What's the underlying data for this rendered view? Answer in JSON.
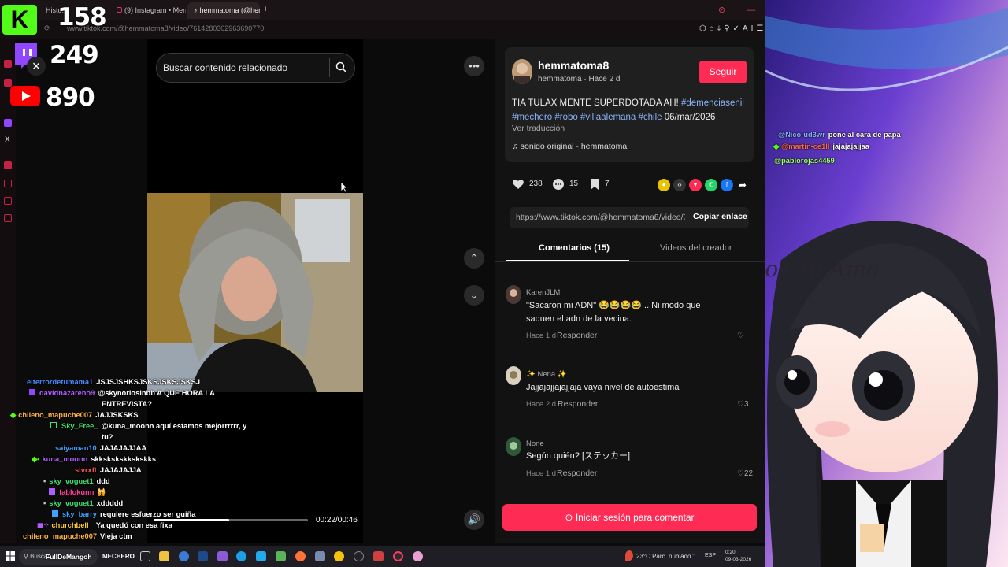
{
  "browser": {
    "tabs": [
      {
        "label": "Histo...",
        "icon": "history-icon"
      },
      {
        "label": "(9) Instagram • Mensajes",
        "icon": "instagram-icon"
      },
      {
        "label": "hemmatoma (@hemm...",
        "icon": "tiktok-icon"
      }
    ],
    "new_tab_label": "+",
    "url": "www.tiktok.com/@hemmatoma8/video/7614280302963690770"
  },
  "overlay": {
    "kick_count": "158",
    "twitch_count": "249",
    "youtube_count": "890",
    "close_label": "×"
  },
  "video": {
    "search_placeholder": "Buscar contenido relacionado",
    "time": "00:22/00:46",
    "progress": 0.49
  },
  "post": {
    "author_name": "hemmatoma8",
    "author_sub": "hemmatoma · Hace 2 d",
    "follow_label": "Seguir",
    "caption_text": "TIA TULAX MENTE SUPERDOTADA AH! ",
    "tags": [
      "#demenciasenil",
      "#mechero",
      "#robo",
      "#villaalemana",
      "#chile"
    ],
    "caption_date": "06/mar/2026",
    "translate_label": "Ver traducción",
    "sound": "sonido original - hemmatoma",
    "likes": "238",
    "comments": "15",
    "saves": "7",
    "link": "https://www.tiktok.com/@hemmatoma8/video/761...",
    "copy_label": "Copiar enlace",
    "tab_comments": "Comentarios (15)",
    "tab_videos": "Videos del creador",
    "login_label": "Iniciar sesión para comentar"
  },
  "comments": [
    {
      "user": "KarenJLM",
      "text": "\"Sacaron mi ADN\" 😂😂😂😂... Ni modo que saquen el adn de la vecina.",
      "time": "Hace 1 d",
      "reply": "Responder",
      "likes": ""
    },
    {
      "user": "✨ Nena ✨",
      "text": "Jajjajajjajajjaja vaya nivel de autoestima",
      "time": "Hace 2 d",
      "reply": "Responder",
      "likes": "3"
    },
    {
      "user": "None",
      "text": "Según quién? [ステッカー]",
      "time": "Hace 1 d",
      "reply": "Responder",
      "likes": "22"
    }
  ],
  "chat": [
    {
      "user": "elterrordetumama1",
      "msg": "JSJSJSHKSJSKSJSKSJSKSJ",
      "color": "#4a8cff"
    },
    {
      "user": "davidnazareno9",
      "msg": "@skynorlosinbb A QUE HORA LA",
      "color": "#b15cff"
    },
    {
      "user": "",
      "msg": "ENTREVISTA?",
      "color": "#ffffff"
    },
    {
      "user": "chileno_mapuche007",
      "msg": "JAJJSKSKS",
      "color": "#ffb347"
    },
    {
      "user": "Sky_Free_",
      "msg": "@kuna_moonn aquí estamos mejorrrrrr, y",
      "color": "#40e070"
    },
    {
      "user": "",
      "msg": "tu?",
      "color": "#ffffff"
    },
    {
      "user": "saiyaman10",
      "msg": "JAJAJAJJAA",
      "color": "#3fa3ff"
    },
    {
      "user": "kuna_moonn",
      "msg": "skkskskskkskskks",
      "color": "#b15cff"
    },
    {
      "user": "slvrxft",
      "msg": "JAJAJAJJA",
      "color": "#ff5252"
    },
    {
      "user": "sky_voguet1",
      "msg": "ddd",
      "color": "#40e070"
    },
    {
      "user": "fablokunn",
      "msg": "🙀",
      "color": "#ff3c9b"
    },
    {
      "user": "sky_voguet1",
      "msg": "xddddd",
      "color": "#40e070"
    },
    {
      "user": "sky_barry",
      "msg": "requiere esfuerzo ser guiña",
      "color": "#3fa3ff"
    },
    {
      "user": "churchbell_",
      "msg": "Ya quedó con esa fixa",
      "color": "#ffcf40"
    },
    {
      "user": "chileno_mapuche007",
      "msg": "Vieja ctm",
      "color": "#ffb347"
    }
  ],
  "right_chat": [
    {
      "user": "@Nico-ud3wr",
      "msg": "pone al cara de papa",
      "color": "#7fb0ff"
    },
    {
      "user": "@martin-ce1ll",
      "msg": "jajajajajjaa",
      "color": "#ff6a4a"
    },
    {
      "user": "@pablorojas4459",
      "msg": "",
      "color": "#9aff6a"
    }
  ],
  "art_text": "Dios Te Ama",
  "taskbar": {
    "search": "Buscar",
    "user_tag": "FullDeMangoh",
    "label2": "MECHERO",
    "weather": "23°C  Parc. nublado",
    "lang": "ESP",
    "time": "0:20",
    "date": "09-03-2026"
  }
}
